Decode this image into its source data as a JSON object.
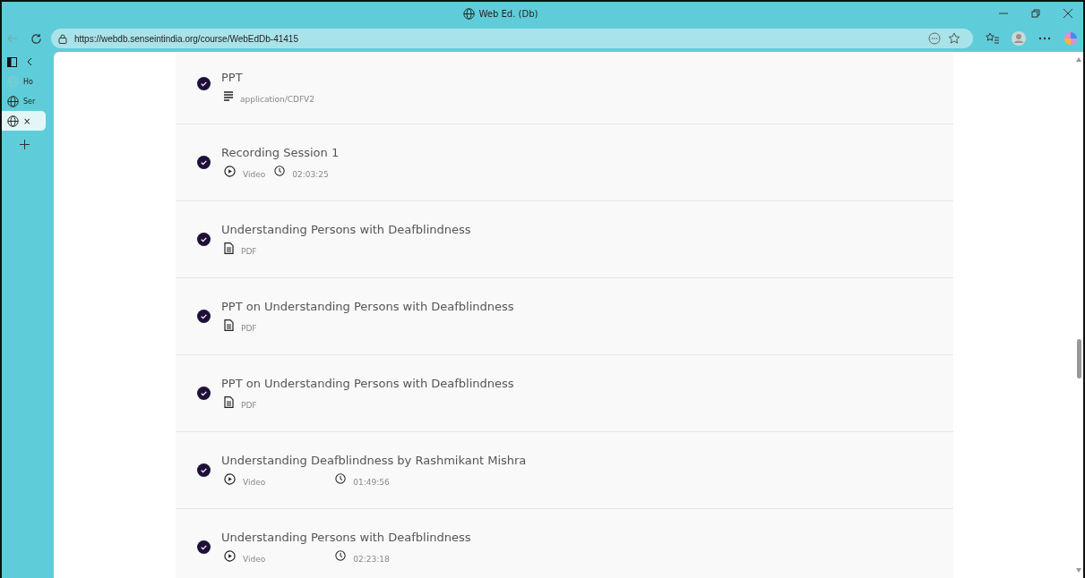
{
  "window": {
    "title": "Web Ed. (Db)"
  },
  "address_bar": {
    "url": "https://webdb.senseintindia.org/course/WebEdDb-41415"
  },
  "sidebar": {
    "tabs": [
      {
        "label": "Ho",
        "selected": false
      },
      {
        "label": "Ser",
        "selected": false
      },
      {
        "label": "×",
        "selected": true
      }
    ]
  },
  "items": [
    {
      "title": "PPT",
      "kind": "document",
      "type_label": "application/CDFV2",
      "completed": true
    },
    {
      "title": "Recording Session 1",
      "kind": "video",
      "type_label": "Video",
      "duration": "02:03:25",
      "completed": true
    },
    {
      "title": "Understanding Persons with Deafblindness",
      "kind": "pdf",
      "type_label": "PDF",
      "completed": true
    },
    {
      "title": "PPT on Understanding Persons with Deafblindness",
      "kind": "pdf",
      "type_label": "PDF",
      "completed": true
    },
    {
      "title": "PPT on Understanding Persons with Deafblindness",
      "kind": "pdf",
      "type_label": "PDF",
      "completed": true
    },
    {
      "title": "Understanding Deafblindness by Rashmikant Mishra",
      "kind": "video",
      "type_label": "Video",
      "duration": "01:49:56",
      "completed": true
    },
    {
      "title": "Understanding Persons with Deafblindness",
      "kind": "video",
      "type_label": "Video",
      "duration": "02:23:18",
      "completed": true
    }
  ]
}
